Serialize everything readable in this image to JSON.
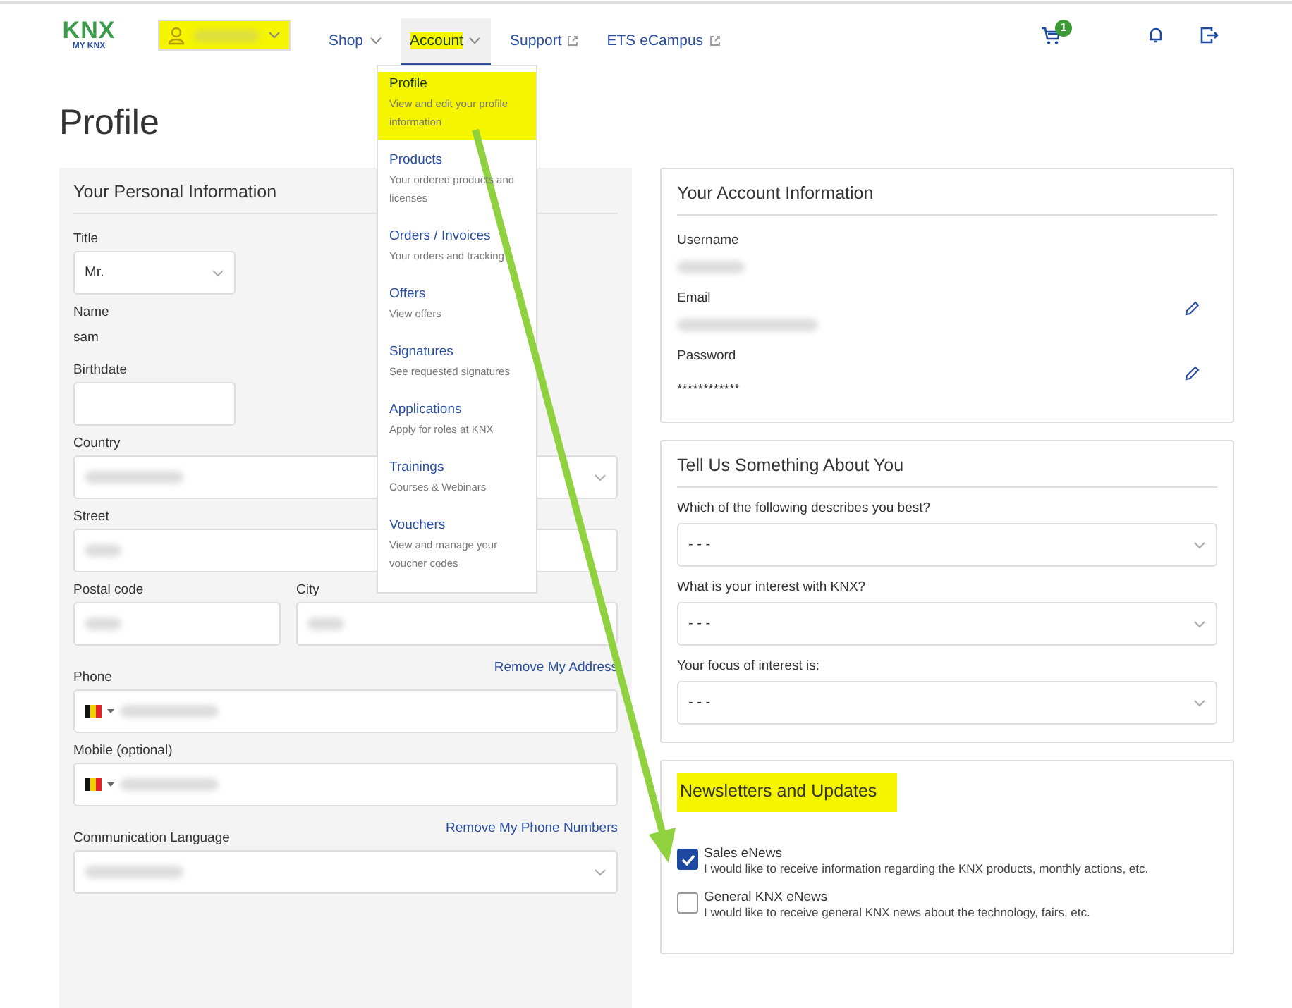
{
  "header": {
    "logo": {
      "mark": "KNX",
      "sub": "MY KNX"
    },
    "user_menu": {
      "highlighted": true
    },
    "nav": [
      {
        "label": "Shop",
        "kind": "dropdown",
        "selected": false,
        "highlighted": false
      },
      {
        "label": "Account",
        "kind": "dropdown",
        "selected": true,
        "highlighted": true
      },
      {
        "label": "Support",
        "kind": "external",
        "selected": false,
        "highlighted": false
      },
      {
        "label": "ETS eCampus",
        "kind": "external",
        "selected": false,
        "highlighted": false
      }
    ],
    "cart_badge": "1"
  },
  "account_menu": [
    {
      "title": "Profile",
      "description": "View and edit your profile information",
      "highlighted": true
    },
    {
      "title": "Products",
      "description": "Your ordered products and licenses",
      "highlighted": false
    },
    {
      "title": "Orders / Invoices",
      "description": "Your orders and tracking",
      "highlighted": false
    },
    {
      "title": "Offers",
      "description": "View offers",
      "highlighted": false
    },
    {
      "title": "Signatures",
      "description": "See requested signatures",
      "highlighted": false
    },
    {
      "title": "Applications",
      "description": "Apply for roles at KNX",
      "highlighted": false
    },
    {
      "title": "Trainings",
      "description": "Courses & Webinars",
      "highlighted": false
    },
    {
      "title": "Vouchers",
      "description": "View and manage your voucher codes",
      "highlighted": false
    }
  ],
  "page_title": "Profile",
  "personal": {
    "title": "Your Personal Information",
    "fields": [
      {
        "kind": "select",
        "label": "Title",
        "value": "Mr."
      },
      {
        "kind": "static",
        "label": "Name",
        "value": "sam"
      },
      {
        "kind": "input",
        "label": "Birthdate"
      },
      {
        "kind": "select",
        "label": "Country"
      },
      {
        "kind": "pair",
        "labels": [
          "Street"
        ]
      },
      {
        "kind": "pair",
        "labels": [
          "Postal code",
          "City"
        ]
      },
      {
        "kind": "link",
        "text": "Remove My Address"
      },
      {
        "kind": "phone",
        "label": "Phone"
      },
      {
        "kind": "phone",
        "label": "Mobile (optional)"
      },
      {
        "kind": "link",
        "text": "Remove My Phone Numbers"
      },
      {
        "kind": "select",
        "label": "Communication Language"
      }
    ]
  },
  "account_info": {
    "title": "Your Account Information",
    "fields": [
      {
        "label": "Username",
        "editable": false
      },
      {
        "label": "Email",
        "editable": true
      },
      {
        "label": "Password",
        "value": "************",
        "editable": true
      }
    ]
  },
  "about_you": {
    "title": "Tell Us Something About You",
    "questions": [
      {
        "label": "Which of the following describes you best?",
        "value": "- - -"
      },
      {
        "label": "What is your interest with KNX?",
        "value": "- - -"
      },
      {
        "label": "Your focus of interest is:",
        "value": "- - -"
      }
    ]
  },
  "newsletters": {
    "title": "Newsletters and Updates",
    "highlighted": true,
    "options": [
      {
        "name": "Sales eNews",
        "description": "I would like to receive information regarding the KNX products, monthly actions, etc.",
        "checked": true
      },
      {
        "name": "General KNX eNews",
        "description": "I would like to receive general KNX news about the technology, fairs, etc.",
        "checked": false
      }
    ]
  }
}
